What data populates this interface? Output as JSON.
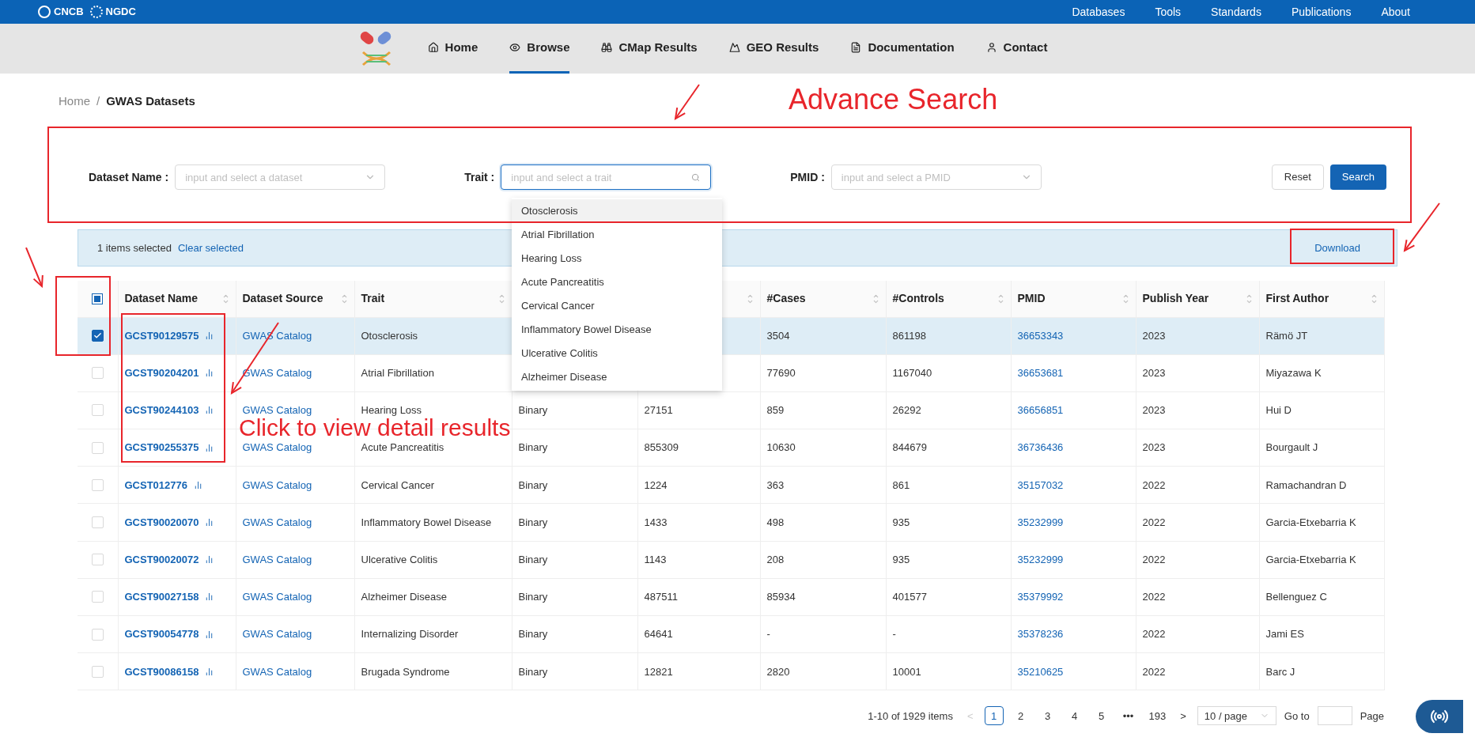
{
  "top_bar": {
    "logo": "CNCB",
    "logo_2": "NGDC",
    "links": [
      "Databases",
      "Tools",
      "Standards",
      "Publications",
      "About"
    ]
  },
  "nav": {
    "items": [
      {
        "label": "Home",
        "selected": false
      },
      {
        "label": "Browse",
        "selected": true
      },
      {
        "label": "CMap Results",
        "selected": false
      },
      {
        "label": "GEO Results",
        "selected": false
      },
      {
        "label": "Documentation",
        "selected": false
      },
      {
        "label": "Contact",
        "selected": false
      }
    ]
  },
  "breadcrumb": [
    "Home",
    "/",
    "GWAS Datasets"
  ],
  "annotations": {
    "search_title": "Advance Search",
    "detail_note": "Click to view detail results"
  },
  "search": {
    "fields": [
      {
        "label": "Dataset Name :",
        "placeholder": "input and select a dataset",
        "kind": "select",
        "focused": false
      },
      {
        "label": "Trait :",
        "placeholder": "input and select a trait",
        "kind": "search",
        "focused": true
      },
      {
        "label": "PMID :",
        "placeholder": "input and select a PMID",
        "kind": "select",
        "focused": false
      }
    ],
    "buttons": [
      "Reset",
      "Search"
    ]
  },
  "dropdown": {
    "options": [
      {
        "label": "Otosclerosis",
        "selected": true
      },
      {
        "label": "Atrial Fibrillation",
        "selected": false
      },
      {
        "label": "Hearing Loss",
        "selected": false
      },
      {
        "label": "Acute Pancreatitis",
        "selected": false
      },
      {
        "label": "Cervical Cancer",
        "selected": false
      },
      {
        "label": "Inflammatory Bowel Disease",
        "selected": false
      },
      {
        "label": "Ulcerative Colitis",
        "selected": false
      },
      {
        "label": "Alzheimer Disease",
        "selected": false
      }
    ]
  },
  "selection_bar": {
    "count": "1 items selected",
    "clear": "Clear selected",
    "download": "Download"
  },
  "table": {
    "header_checkbox": {
      "indeterminate": true
    },
    "columns": [
      {
        "label": "Dataset Name",
        "sortable": true
      },
      {
        "label": "Dataset Source",
        "sortable": true
      },
      {
        "label": "Trait",
        "sortable": true
      },
      {},
      {
        "sortable": true
      },
      {
        "label": "#Cases",
        "sortable": true
      },
      {
        "label": "#Controls",
        "sortable": true
      },
      {
        "label": "PMID",
        "sortable": true
      },
      {
        "label": "Publish Year",
        "sortable": true
      },
      {
        "label": "First Author",
        "sortable": true
      }
    ],
    "rows": [
      {
        "selected": true,
        "cells": [
          "GCST90129575",
          "GWAS Catalog",
          "Otosclerosis",
          null,
          null,
          "3504",
          "861198",
          "36653343",
          "2023",
          "Rämö JT"
        ]
      },
      {
        "selected": false,
        "cells": [
          "GCST90204201",
          "GWAS Catalog",
          "Atrial Fibrillation",
          null,
          null,
          "77690",
          "1167040",
          "36653681",
          "2023",
          "Miyazawa K"
        ]
      },
      {
        "selected": false,
        "cells": [
          "GCST90244103",
          "GWAS Catalog",
          "Hearing Loss",
          "Binary",
          "27151",
          "859",
          "26292",
          "36656851",
          "2023",
          "Hui D"
        ]
      },
      {
        "selected": false,
        "cells": [
          "GCST90255375",
          "GWAS Catalog",
          "Acute Pancreatitis",
          "Binary",
          "855309",
          "10630",
          "844679",
          "36736436",
          "2023",
          "Bourgault J"
        ]
      },
      {
        "selected": false,
        "cells": [
          "GCST012776",
          "GWAS Catalog",
          "Cervical Cancer",
          "Binary",
          "1224",
          "363",
          "861",
          "35157032",
          "2022",
          "Ramachandran D"
        ]
      },
      {
        "selected": false,
        "cells": [
          "GCST90020070",
          "GWAS Catalog",
          "Inflammatory Bowel Disease",
          "Binary",
          "1433",
          "498",
          "935",
          "35232999",
          "2022",
          "Garcia-Etxebarria K"
        ]
      },
      {
        "selected": false,
        "cells": [
          "GCST90020072",
          "GWAS Catalog",
          "Ulcerative Colitis",
          "Binary",
          "1143",
          "208",
          "935",
          "35232999",
          "2022",
          "Garcia-Etxebarria K"
        ]
      },
      {
        "selected": false,
        "cells": [
          "GCST90027158",
          "GWAS Catalog",
          "Alzheimer Disease",
          "Binary",
          "487511",
          "85934",
          "401577",
          "35379992",
          "2022",
          "Bellenguez C"
        ]
      },
      {
        "selected": false,
        "cells": [
          "GCST90054778",
          "GWAS Catalog",
          "Internalizing Disorder",
          "Binary",
          "64641",
          "-",
          "-",
          "35378236",
          "2022",
          "Jami ES"
        ]
      },
      {
        "selected": false,
        "cells": [
          "GCST90086158",
          "GWAS Catalog",
          "Brugada Syndrome",
          "Binary",
          "12821",
          "2820",
          "10001",
          "35210625",
          "2022",
          "Barc J"
        ]
      }
    ]
  },
  "pagination": {
    "summary": "1-10 of 1929 items",
    "prev": "<",
    "pages": [
      {
        "label": "1",
        "selected": true
      },
      {
        "label": "2",
        "selected": false
      },
      {
        "label": "3",
        "selected": false
      },
      {
        "label": "4",
        "selected": false
      },
      {
        "label": "5",
        "selected": false
      },
      {
        "label": "•••",
        "selected": false
      },
      {
        "label": "193",
        "selected": false
      }
    ],
    "next": ">",
    "page_size": "10 / page",
    "goto": "Go to",
    "page": "Page"
  }
}
